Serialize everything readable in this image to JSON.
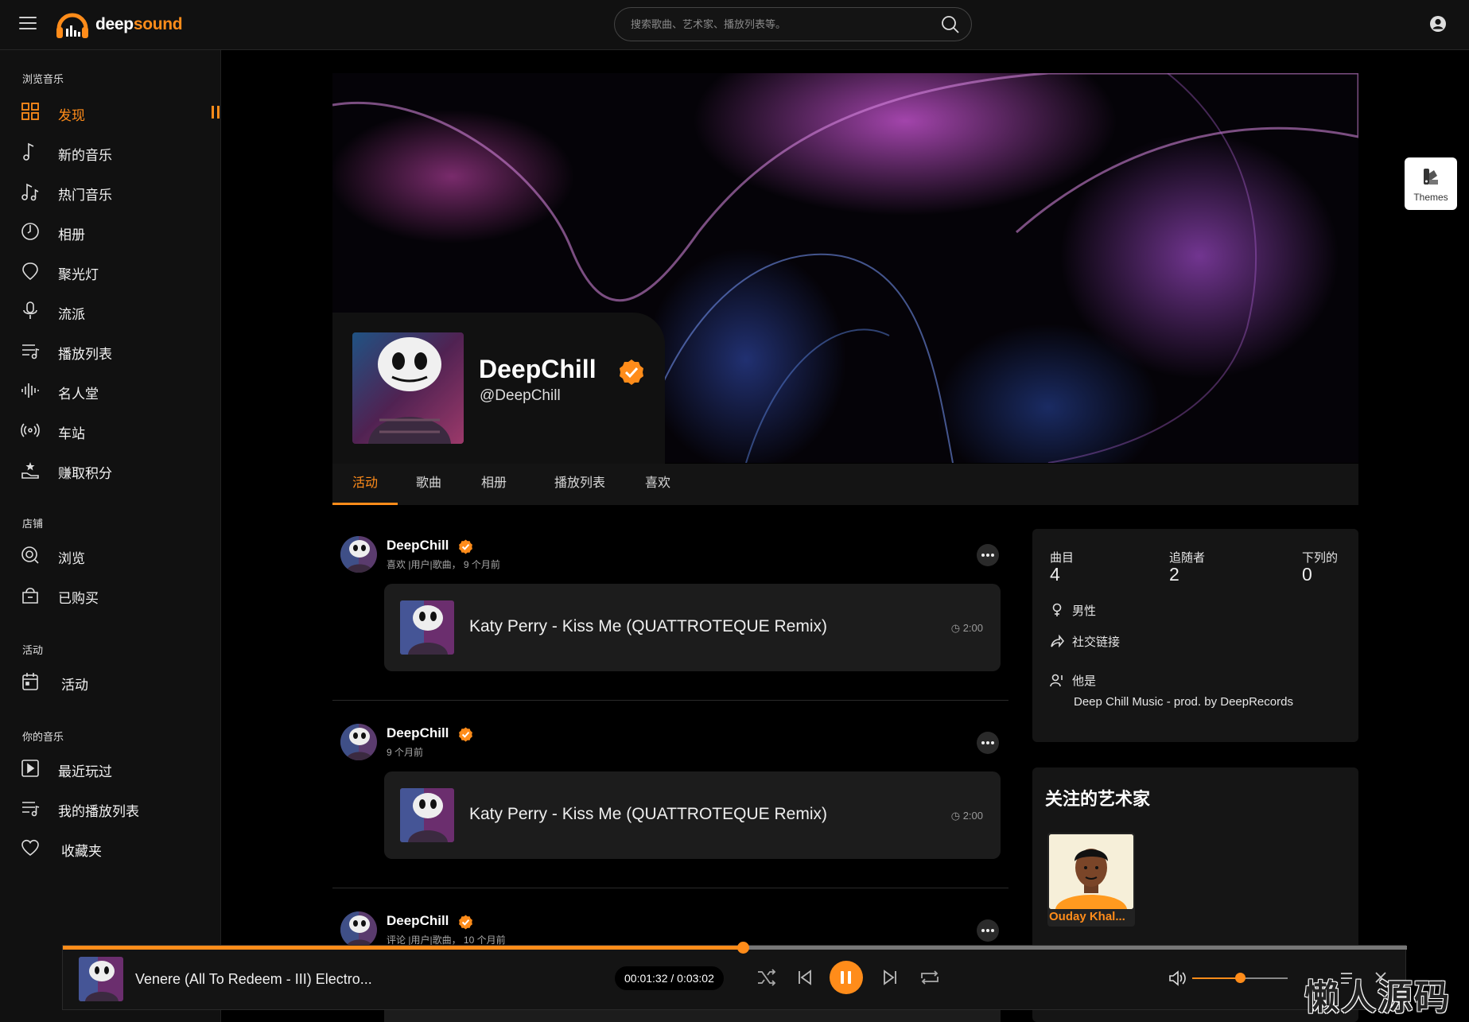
{
  "app": {
    "brand_a": "deep",
    "brand_b": "sound",
    "accent_color": "#ff8c1a"
  },
  "search": {
    "placeholder": "搜索歌曲、艺术家、播放列表等。"
  },
  "sidebar": {
    "section_browse": "浏览音乐",
    "browse_items": [
      {
        "label": "发现",
        "icon": "grid-icon",
        "active": true
      },
      {
        "label": "新的音乐",
        "icon": "music-note-icon"
      },
      {
        "label": "热门音乐",
        "icon": "music-notes-icon"
      },
      {
        "label": "相册",
        "icon": "album-disc-icon"
      },
      {
        "label": "聚光灯",
        "icon": "spotlight-icon"
      },
      {
        "label": "流派",
        "icon": "microphone-icon"
      },
      {
        "label": "播放列表",
        "icon": "playlist-icon"
      },
      {
        "label": "名人堂",
        "icon": "waveform-icon"
      },
      {
        "label": "车站",
        "icon": "radio-station-icon"
      },
      {
        "label": "赚取积分",
        "icon": "earn-points-icon"
      }
    ],
    "section_store": "店铺",
    "store_items": [
      {
        "label": "浏览",
        "icon": "browse-icon"
      },
      {
        "label": "已购买",
        "icon": "purchased-bag-icon"
      }
    ],
    "section_events": "活动",
    "event_items": [
      {
        "label": "活动",
        "icon": "calendar-icon"
      }
    ],
    "section_yours": "你的音乐",
    "your_items": [
      {
        "label": "最近玩过",
        "icon": "recent-play-icon"
      },
      {
        "label": "我的播放列表",
        "icon": "my-playlist-icon"
      },
      {
        "label": "收藏夹",
        "icon": "heart-icon"
      }
    ]
  },
  "profile": {
    "name": "DeepChill",
    "handle": "@DeepChill"
  },
  "tabs": [
    "活动",
    "歌曲",
    "相册",
    "播放列表",
    "喜欢"
  ],
  "feed": [
    {
      "user": "DeepChill",
      "meta": "喜欢 |用户|歌曲， 9 个月前",
      "track": "Katy Perry - Kiss Me (QUATTROTEQUE Remix)",
      "duration": "2:00"
    },
    {
      "user": "DeepChill",
      "meta": "9 个月前",
      "track": "Katy Perry - Kiss Me (QUATTROTEQUE Remix)",
      "duration": "2:00"
    },
    {
      "user": "DeepChill",
      "meta": "评论 |用户|歌曲， 10 个月前",
      "track": "",
      "duration": ""
    }
  ],
  "stats": {
    "tracks_label": "曲目",
    "tracks_value": "4",
    "followers_label": "追随者",
    "followers_value": "2",
    "following_label": "下列的",
    "following_value": "0",
    "gender": "男性",
    "social": "社交链接",
    "about_label": "他是",
    "about_text": "Deep Chill Music - prod. by DeepRecords"
  },
  "artists": {
    "title": "关注的艺术家",
    "items": [
      {
        "name": "Ouday Khal..."
      }
    ]
  },
  "themes_label": "Themes",
  "player": {
    "title": "Venere (All To Redeem - III) Electro...",
    "time": "00:01:32 / 0:03:02",
    "progress": 0.506,
    "volume": 0.5
  },
  "watermark": "懒人源码"
}
